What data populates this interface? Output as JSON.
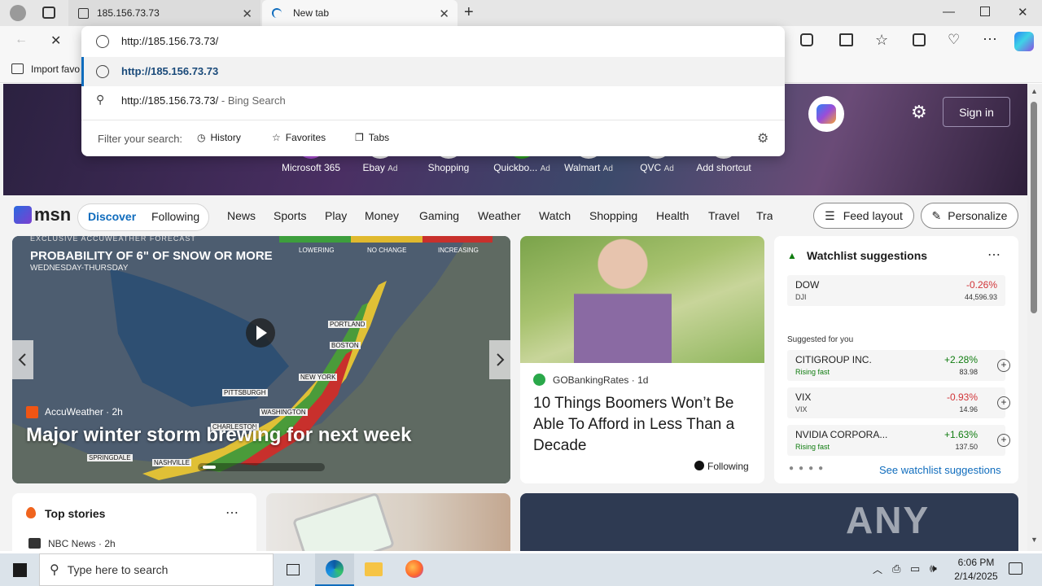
{
  "browser": {
    "tabs": [
      {
        "title": "185.156.73.73"
      },
      {
        "title": "New tab"
      }
    ],
    "address": "http://185.156.73.73/",
    "favorites_bar_item": "Import favo"
  },
  "dropdown": {
    "suggestion_1": "http://185.156.73.73",
    "suggestion_2_text": "http://185.156.73.73/",
    "suggestion_2_suffix": "- Bing Search",
    "filter_label": "Filter your search:",
    "filters": [
      "History",
      "Favorites",
      "Tabs"
    ]
  },
  "hero": {
    "shortcuts": [
      {
        "label": "Microsoft 365",
        "ad": ""
      },
      {
        "label": "Ebay",
        "ad": "Ad"
      },
      {
        "label": "Shopping",
        "ad": ""
      },
      {
        "label": "Quickbo...",
        "ad": "Ad"
      },
      {
        "label": "Walmart",
        "ad": "Ad"
      },
      {
        "label": "QVC",
        "ad": "Ad"
      },
      {
        "label": "Add shortcut",
        "ad": ""
      }
    ],
    "signin": "Sign in"
  },
  "nav": {
    "logo": "msn",
    "discover": "Discover",
    "following": "Following",
    "links": [
      "News",
      "Sports",
      "Play",
      "Money",
      "Gaming",
      "Weather",
      "Watch",
      "Shopping",
      "Health",
      "Travel",
      "Tra"
    ],
    "feed_layout": "Feed layout",
    "personalize": "Personalize"
  },
  "main_card": {
    "banner": "EXCLUSIVE ACCUWEATHER FORECAST",
    "map_title": "PROBABILITY OF 6\" OF SNOW OR MORE",
    "map_subtitle": "WEDNESDAY-THURSDAY",
    "legend": [
      "LOWERING",
      "NO CHANGE",
      "INCREASING"
    ],
    "cities": [
      "PORTLAND",
      "BOSTON",
      "NEW YORK",
      "PITTSBURGH",
      "WASHINGTON",
      "CHARLESTON",
      "SPRINGDALE",
      "NASHVILLE"
    ],
    "source": "AccuWeather",
    "age": "2h",
    "headline": "Major winter storm brewing for next week"
  },
  "boomers_card": {
    "source": "GOBankingRates",
    "age": "1d",
    "headline": "10 Things Boomers Won’t Be Able To Afford in Less Than a Decade",
    "following": "Following"
  },
  "watchlist": {
    "title": "Watchlist suggestions",
    "dow": {
      "name": "DOW",
      "ticker": "DJI",
      "change": "-0.26%",
      "price": "44,596.93"
    },
    "suggested_label": "Suggested for you",
    "stocks": [
      {
        "name": "CITIGROUP INC.",
        "sub": "Rising fast",
        "change": "+2.28%",
        "price": "83.98"
      },
      {
        "name": "VIX",
        "sub": "VIX",
        "change": "-0.93%",
        "price": "14.96"
      },
      {
        "name": "NVIDIA CORPORA...",
        "sub": "Rising fast",
        "change": "+1.63%",
        "price": "137.50"
      }
    ],
    "see_more": "See watchlist suggestions"
  },
  "top_stories": {
    "title": "Top stories",
    "source": "NBC News",
    "age": "2h"
  },
  "watermark": "ANY RUN",
  "taskbar": {
    "search_placeholder": "Type here to search",
    "time": "6:06 PM",
    "date": "2/14/2025"
  },
  "colors": {
    "accent": "#0f6cbd",
    "negative": "#d13438",
    "positive": "#107c10"
  }
}
